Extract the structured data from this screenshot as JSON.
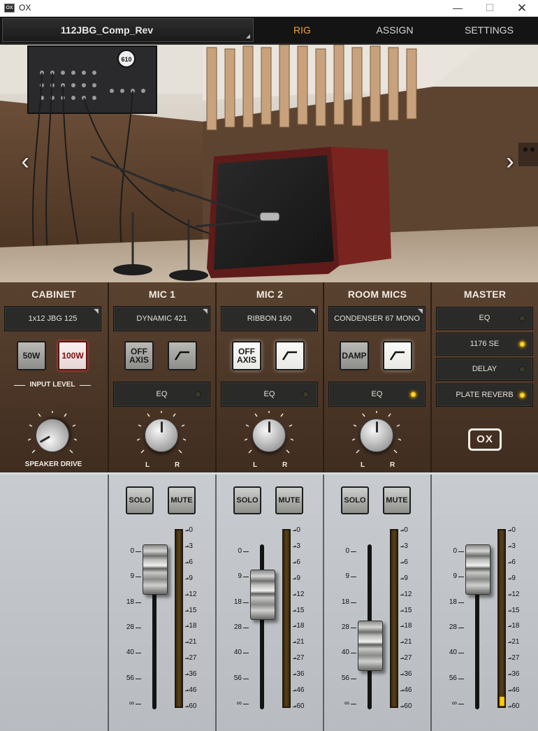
{
  "window": {
    "icon_text": "OX",
    "title": "OX",
    "minimize": "—",
    "maximize": "☐",
    "close": "✕"
  },
  "topnav": {
    "preset": "112JBG_Comp_Rev",
    "tabs": [
      "RIG",
      "ASSIGN",
      "SETTINGS"
    ],
    "active_tab": "RIG",
    "accent_color": "#f2a23a"
  },
  "scene": {
    "prev_arrow": "‹",
    "next_arrow": "›",
    "patchbay_label": "610"
  },
  "cabinet": {
    "header": "CABINET",
    "selector": "1x12 JBG 125",
    "btn_50w": "50W",
    "btn_100w": "100W",
    "active_power": "100W",
    "input_level": "INPUT LEVEL",
    "speaker_drive": "SPEAKER DRIVE"
  },
  "mic1": {
    "header": "MIC 1",
    "selector": "DYNAMIC 421",
    "axis_line1": "OFF",
    "axis_line2": "AXIS",
    "eq_label": "EQ",
    "eq_on": false,
    "hpf_on": false,
    "pan_l": "L",
    "pan_r": "R",
    "solo": "SOLO",
    "mute": "MUTE",
    "fader_db": 0,
    "meter_level": 0
  },
  "mic2": {
    "header": "MIC 2",
    "selector": "RIBBON 160",
    "axis_line1": "OFF",
    "axis_line2": "AXIS",
    "eq_label": "EQ",
    "eq_on": false,
    "hpf_on": true,
    "pan_l": "L",
    "pan_r": "R",
    "solo": "SOLO",
    "mute": "MUTE",
    "fader_db": -9,
    "meter_level": 0
  },
  "room": {
    "header": "ROOM MICS",
    "selector": "CONDENSER 67 MONO",
    "damp": "DAMP",
    "eq_label": "EQ",
    "eq_on": true,
    "hpf_on": true,
    "pan_l": "L",
    "pan_r": "R",
    "solo": "SOLO",
    "mute": "MUTE",
    "fader_db": -28,
    "meter_level": 0
  },
  "master": {
    "header": "MASTER",
    "rows": [
      {
        "label": "EQ",
        "on": false
      },
      {
        "label": "1176 SE",
        "on": true
      },
      {
        "label": "DELAY",
        "on": false
      },
      {
        "label": "PLATE REVERB",
        "on": true
      }
    ],
    "logo": "OX",
    "fader_db": 0,
    "meter_level": 0.05
  },
  "fader_scale": [
    "0",
    "9",
    "18",
    "28",
    "40",
    "56",
    "∞"
  ],
  "meter_scale": [
    "0",
    "3",
    "6",
    "9",
    "12",
    "15",
    "18",
    "21",
    "27",
    "36",
    "46",
    "60"
  ],
  "colors": {
    "led_on": "#f3b900",
    "panel_brown": "#4a3526",
    "metal": "#bfc3c7"
  }
}
